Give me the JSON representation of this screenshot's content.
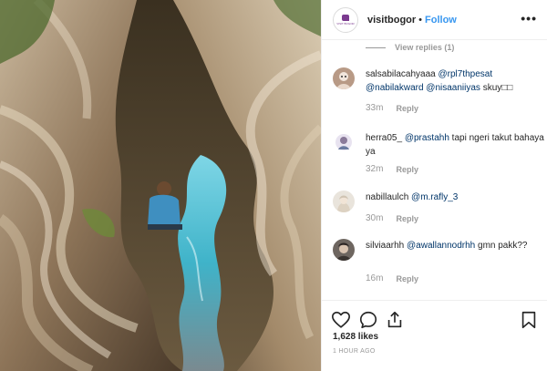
{
  "post": {
    "username": "visitbogor",
    "separator": "•",
    "follow_label": "Follow",
    "more_icon": "more-options-icon",
    "logo_text": "VISIT BOGOR"
  },
  "view_replies": "View replies (1)",
  "comments": [
    {
      "username": "salsabilacahyaaa",
      "mentions": "@rpl7thpesat @nabilakward @nisaaniiyas",
      "tail": "skuy□□",
      "time": "33m",
      "reply": "Reply"
    },
    {
      "username": "herra05_",
      "mentions": "@prastahh",
      "tail": "tapi ngeri takut bahaya ya",
      "time": "32m",
      "reply": "Reply"
    },
    {
      "username": "nabillaulch",
      "mentions": "@m.rafly_3",
      "tail": "",
      "time": "30m",
      "reply": "Reply"
    },
    {
      "username": "silviaarhh",
      "mentions": "@awallannodrhh",
      "tail": "gmn pakk??",
      "time": "16m",
      "reply": "Reply"
    }
  ],
  "actions": {
    "like_icon": "heart-icon",
    "comment_icon": "comment-icon",
    "share_icon": "share-icon",
    "save_icon": "bookmark-icon",
    "likes": "1,628 likes",
    "time_ago": "1 HOUR AGO"
  },
  "colors": {
    "accent": "#3897f0",
    "mention": "#003569",
    "muted": "#999999",
    "brand": "#7b3a8f"
  }
}
